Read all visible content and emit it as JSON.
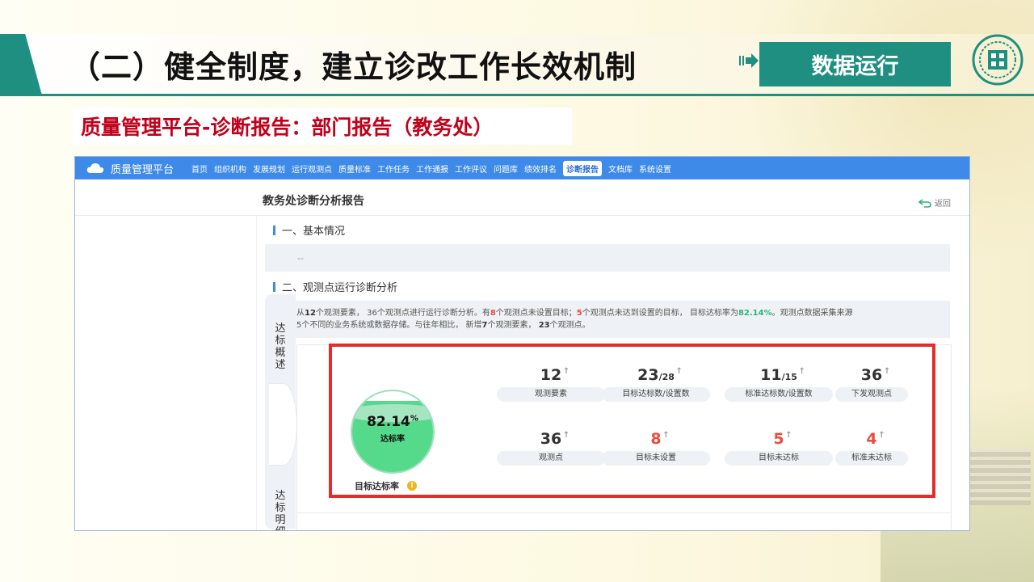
{
  "slide": {
    "title": "（二）健全制度，建立诊改工作长效机制",
    "section_badge": "数据运行",
    "subtitle": "质量管理平台-诊断报告：部门报告（教务处）"
  },
  "app": {
    "brand": "质量管理平台",
    "nav": [
      "首页",
      "组织机构",
      "发展规划",
      "运行观测点",
      "质量标准",
      "工作任务",
      "工作通报",
      "工作评议",
      "问题库",
      "绩效排名",
      "诊断报告",
      "文档库",
      "系统设置"
    ],
    "nav_active": "诊断报告",
    "report_title": "教务处诊断分析报告",
    "back_label": "返回",
    "section1": {
      "title": "一、基本情况",
      "value": "--"
    },
    "section2": {
      "title": "二、观测点运行诊断分析"
    },
    "summary": {
      "p1": "从",
      "n1": "12",
      "p2": "个观测要素，  36个观测点进行运行诊断分析。有",
      "n2": "8",
      "p3": "个观测点未设置目标；",
      "n3": "5",
      "p4": "个观测点未达到设置的目标，  目标达标率为",
      "n4": "82.14%",
      "p5": "。观测点数据采集来源",
      "line2a": "5个不同的业务系统或数据存储。与往年相比，  新增",
      "n5": "7",
      "line2b": "个观测要素，  ",
      "n6": "23",
      "line2c": "个观测点。"
    },
    "tabs": [
      "达标概述",
      "达标明细"
    ],
    "gauge": {
      "value": "82.14",
      "unit": "%",
      "label": "达标率",
      "caption": "目标达标率",
      "fraction": 0.8214
    },
    "stats": [
      {
        "value": "12",
        "suffix": "",
        "label": "观测要素",
        "red": false
      },
      {
        "value": "23",
        "suffix": "/28",
        "label": "目标达标数/设置数",
        "red": false
      },
      {
        "value": "11",
        "suffix": "/15",
        "label": "标准达标数/设置数",
        "red": false
      },
      {
        "value": "36",
        "suffix": "",
        "label": "下发观测点",
        "red": false
      },
      {
        "value": "36",
        "suffix": "",
        "label": "观测点",
        "red": false
      },
      {
        "value": "8",
        "suffix": "",
        "label": "目标未设置",
        "red": true
      },
      {
        "value": "5",
        "suffix": "",
        "label": "目标未达标",
        "red": true
      },
      {
        "value": "4",
        "suffix": "",
        "label": "标准未达标",
        "red": true
      }
    ],
    "colors": {
      "nav": "#3d8ae8",
      "accent": "#1e8f80",
      "highlight": "#e52b2b",
      "gauge": "#55d98b"
    }
  }
}
